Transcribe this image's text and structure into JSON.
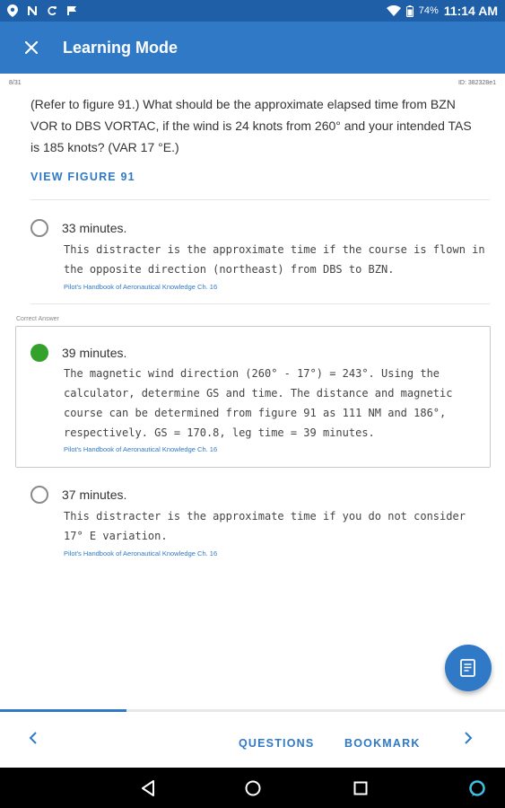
{
  "status_bar": {
    "left_icons": [
      "location-icon",
      "n-icon",
      "c-icon",
      "flag-icon"
    ],
    "battery_percent": "74%",
    "time": "11:14 AM"
  },
  "app_bar": {
    "title": "Learning Mode",
    "close_icon": "close-icon"
  },
  "meta": {
    "position": "8/31",
    "id": "ID: 382328e1"
  },
  "question": {
    "text": "(Refer to figure 91.) What should be the approximate elapsed time from BZN VOR to DBS VORTAC, if the wind is 24 knots from 260° and your intended TAS is 185 knots? (VAR 17 °E.)",
    "view_figure_label": "VIEW FIGURE 91"
  },
  "correct_answer_label": "Correct Answer",
  "answers": [
    {
      "label": "33 minutes.",
      "explanation": "This distracter is the approximate time if the course is flown in the opposite direction (northeast) from DBS to BZN.",
      "reference": "Pilot's Handbook of Aeronautical Knowledge Ch. 16",
      "correct": false
    },
    {
      "label": "39 minutes.",
      "explanation": "The magnetic wind direction (260° - 17°) = 243°.  Using the calculator, determine GS and time.  The distance and magnetic course can be determined from figure 91 as 111 NM and 186°, respectively.  GS = 170.8, leg time = 39 minutes.",
      "reference": "Pilot's Handbook of Aeronautical Knowledge Ch. 16",
      "correct": true
    },
    {
      "label": "37 minutes.",
      "explanation": "This distracter is the approximate time if you do not consider 17° E variation.",
      "reference": "Pilot's Handbook of Aeronautical Knowledge Ch. 16",
      "correct": false
    }
  ],
  "fab": {
    "icon": "notes-icon"
  },
  "progress": {
    "fraction": 0.25
  },
  "bottom_nav": {
    "prev_icon": "chevron-left-icon",
    "questions_label": "QUESTIONS",
    "bookmark_label": "BOOKMARK",
    "next_icon": "chevron-right-icon"
  },
  "system_nav": [
    "back-icon",
    "home-icon",
    "recents-icon",
    "assistant-icon"
  ],
  "colors": {
    "status_bar": "#1e5fa8",
    "app_bar": "#2f79c6",
    "accent": "#2f79c6",
    "correct": "#33a12a"
  }
}
